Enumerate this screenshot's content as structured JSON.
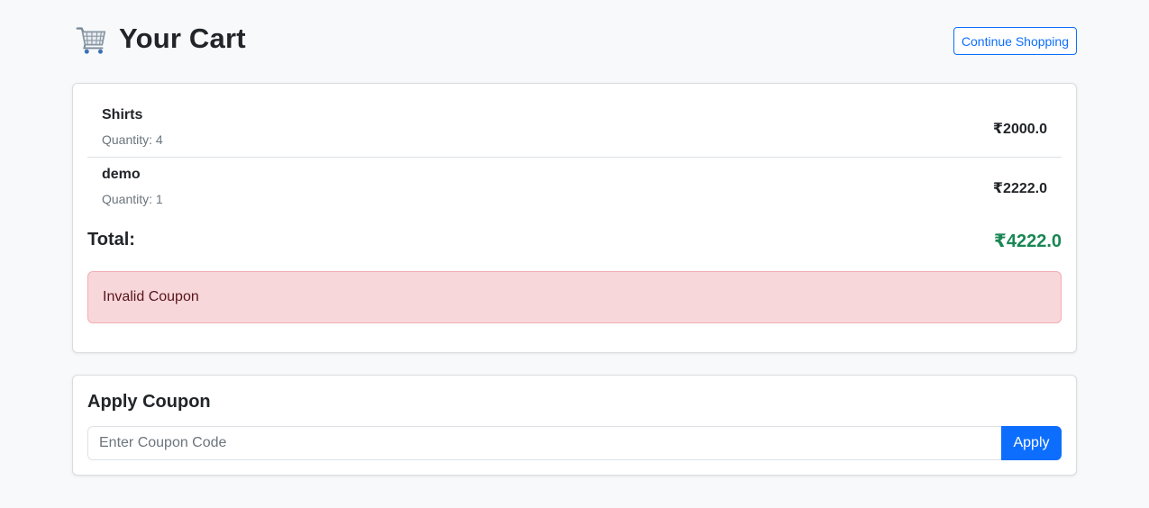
{
  "header": {
    "title": "Your Cart",
    "icon": "shopping-cart-icon",
    "continue_label": "Continue Shopping"
  },
  "cart": {
    "items": [
      {
        "name": "Shirts",
        "quantity_text": "Quantity: 4",
        "price": "₹2000.0"
      },
      {
        "name": "demo",
        "quantity_text": "Quantity: 1",
        "price": "₹2222.0"
      }
    ],
    "total_label": "Total:",
    "total_value": "₹4222.0",
    "alert_text": "Invalid Coupon"
  },
  "coupon": {
    "title": "Apply Coupon",
    "placeholder": "Enter Coupon Code",
    "value": "",
    "apply_label": "Apply"
  },
  "colors": {
    "primary": "#0d6efd",
    "success": "#198754",
    "danger_bg": "#f8d7da",
    "danger_text": "#58151c"
  }
}
